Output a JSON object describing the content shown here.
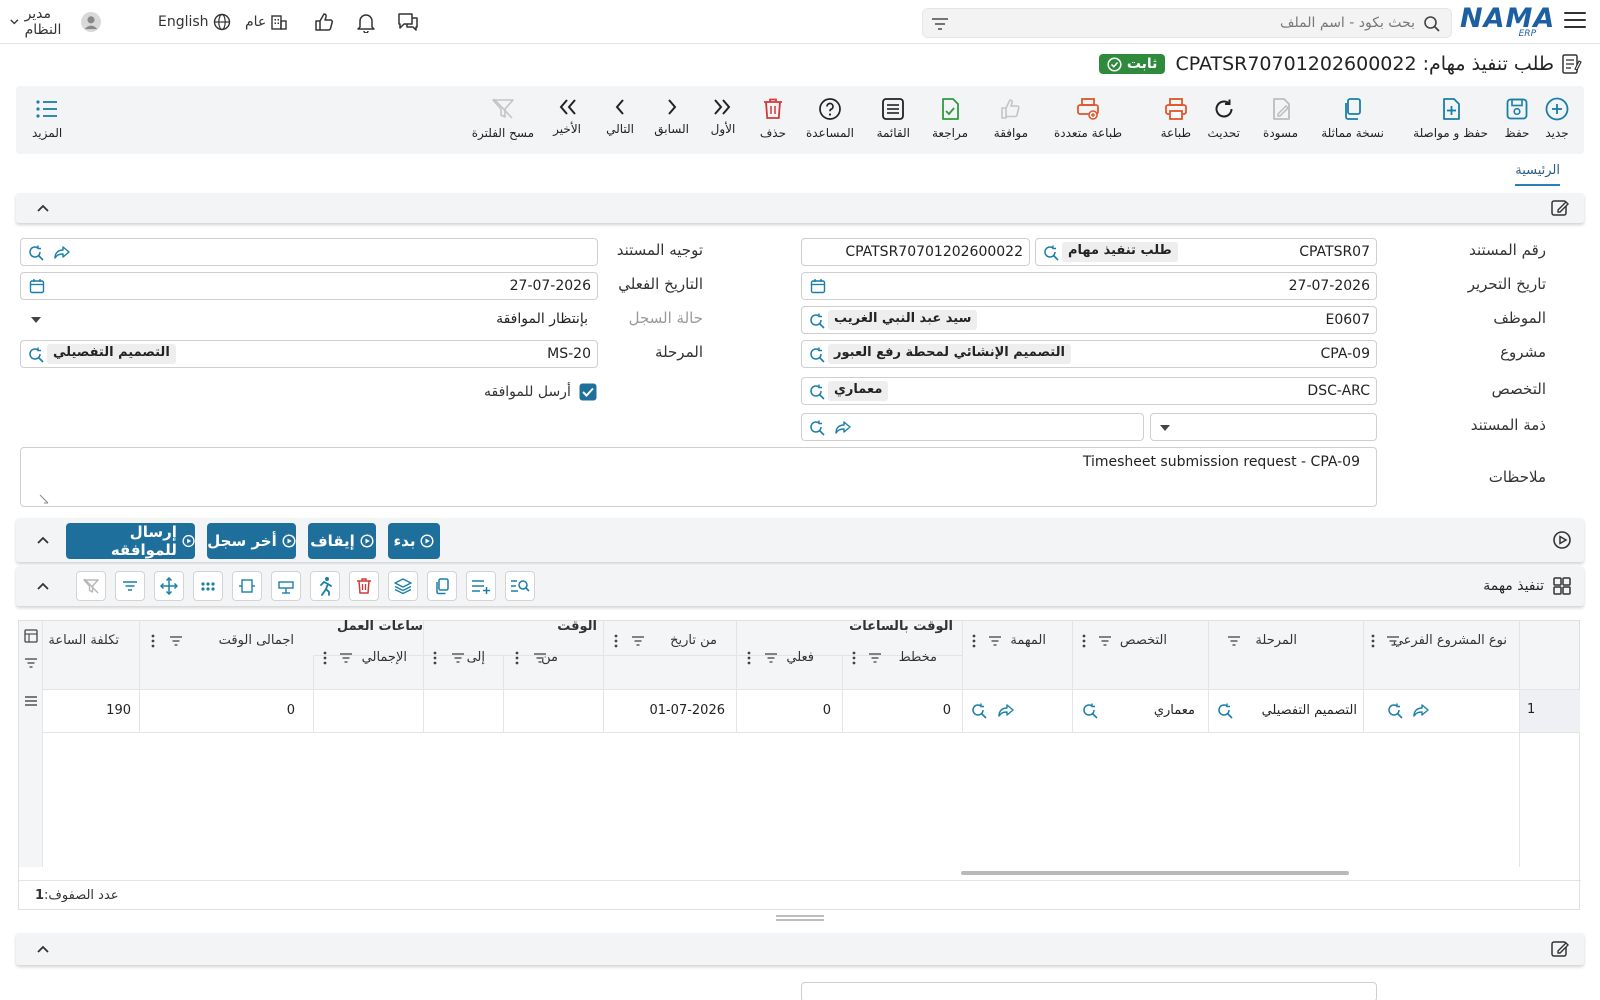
{
  "header": {
    "logo_text": "NAMA",
    "logo_sub": "ERP",
    "search_placeholder": "بحث بكود - اسم الملف",
    "user_name": "مدير النظام",
    "language": "English",
    "company_scope": "عام"
  },
  "document": {
    "title": "طلب تنفيذ مهام: CPATSR70701202600022",
    "status": "ثابت"
  },
  "toolbar": {
    "new": "جديد",
    "save": "حفظ",
    "save_continue": "حفظ و مواصلة",
    "duplicate": "نسخة مماثلة",
    "draft": "مسودة",
    "refresh": "تحديث",
    "print": "طباعة",
    "multi_print": "طباعة متعددة",
    "approve": "موافقة",
    "review": "مراجعة",
    "list": "القائمة",
    "help": "المساعدة",
    "delete": "حذف",
    "first": "الأول",
    "previous": "السابق",
    "next": "التالي",
    "last": "الأخير",
    "clear_filter": "مسح الفلترة",
    "more": "المزيد"
  },
  "tabs": {
    "main": "الرئيسية"
  },
  "form": {
    "doc_no_label": "رقم المستند",
    "doc_no_code": "CPATSR07",
    "doc_no_type": "طلب تنفيذ مهام",
    "doc_no_value": "CPATSR70701202600022",
    "edit_date_label": "تاريخ التحرير",
    "edit_date": "27-07-2026",
    "employee_label": "الموظف",
    "employee_code": "E0607",
    "employee_name": "سيد عبد النبي الغريب",
    "project_label": "مشروع",
    "project_code": "CPA-09",
    "project_name": "التصميم الإنشائي لمحطة رفع العبور",
    "specialty_label": "التخصص",
    "specialty_code": "DSC-ARC",
    "specialty_name": "معماري",
    "doc_liability_label": "ذمة المستند",
    "notes_label": "ملاحظات",
    "notes": "Timesheet submission request - CPA-09",
    "doc_direction_label": "توجيه المستند",
    "actual_date_label": "التاريخ الفعلي",
    "actual_date": "27-07-2026",
    "record_status_label": "حالة السجل",
    "record_status": "بإنتظار الموافقة",
    "stage_label": "المرحلة",
    "stage_code": "MS-20",
    "stage_name": "التصميم التفصيلي",
    "send_for_approval": "أرسل للموافقه"
  },
  "actions": {
    "start": "بدء",
    "stop": "إيقاف",
    "last_record": "أخر سجل",
    "send_approval": "إرسال للموافقه"
  },
  "task_section": {
    "title": "تنفيذ مهمة"
  },
  "grid": {
    "headers": {
      "subproject_type": "نوع المشروع الفرعي",
      "stage": "المرحلة",
      "specialty": "التخصص",
      "task": "المهمة",
      "hours_group": "الوقت بالساعات",
      "planned": "مخطط",
      "actual": "فعلي",
      "from_date": "من تاريخ",
      "time_group": "الوقت",
      "from": "من",
      "to": "إلى",
      "work_hours_group": "ساعات العمل",
      "total": "الإجمالي",
      "total_time": "اجمالى الوقت",
      "hour_cost": "تكلفة الساعة"
    },
    "rows": [
      {
        "num": "1",
        "stage": "التصميم التفصيلي",
        "specialty": "معماري",
        "planned": "0",
        "actual": "0",
        "from_date": "01-07-2026",
        "total_time": "0",
        "hour_cost": "190"
      }
    ],
    "row_count_label": "عدد الصفوف:",
    "row_count": "1"
  },
  "colors": {
    "primary": "#1f6f9c",
    "teal": "#1a7fa8",
    "status_green": "#2e8b3d",
    "orange": "#e0572a",
    "red": "#d13a3a"
  }
}
